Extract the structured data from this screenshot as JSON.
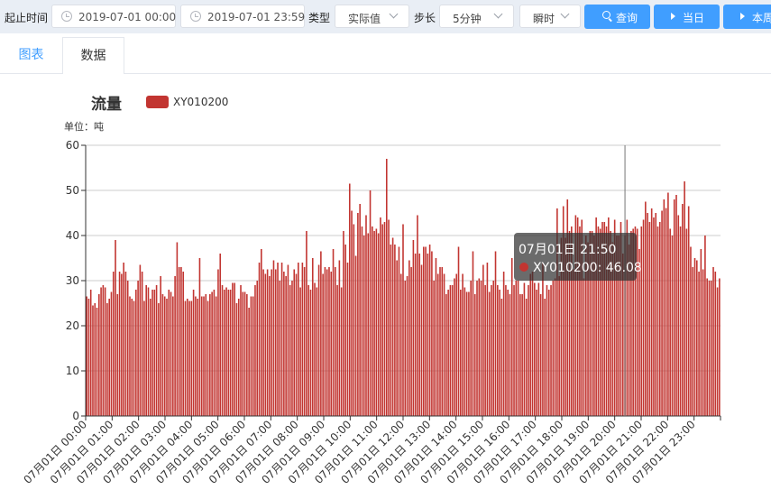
{
  "toolbar": {
    "range_label": "起止时间",
    "start": "2019-07-01 00:00",
    "end": "2019-07-01 23:59",
    "type_label": "类型",
    "type_value": "实际值",
    "step_label": "步长",
    "step_value": "5分钟",
    "mode_value": "瞬时",
    "query_btn": "查询",
    "today_btn": "当日",
    "week_btn": "本周"
  },
  "tabs": {
    "chart": "图表",
    "data": "数据"
  },
  "colors": {
    "bar": "#c23531",
    "accent": "#409eff",
    "toolbar_bg": "#e9eef5"
  },
  "chart_data": {
    "type": "bar",
    "title": "流量",
    "unit_label": "单位：吨",
    "ylim": [
      0,
      60
    ],
    "y_ticks": [
      "0",
      "10",
      "20",
      "30",
      "40",
      "50",
      "60"
    ],
    "grid": true,
    "legend": {
      "position": "top",
      "entries": [
        "XY010200"
      ]
    },
    "x_tick_labels": [
      "07月01日 00:00",
      "07月01日 01:00",
      "07月01日 02:00",
      "07月01日 03:00",
      "07月01日 04:00",
      "07月01日 05:00",
      "07月01日 06:00",
      "07月01日 07:00",
      "07月01日 08:00",
      "07月01日 09:00",
      "07月01日 10:00",
      "07月01日 11:00",
      "07月01日 12:00",
      "07月01日 13:00",
      "07月01日 14:00",
      "07月01日 15:00",
      "07月01日 16:00",
      "07月01日 17:00",
      "07月01日 18:00",
      "07月01日 19:00",
      "07月01日 20:00",
      "07月01日 21:00",
      "07月01日 22:00",
      "07月01日 23:00"
    ],
    "tooltip": {
      "time": "07月01日 21:50",
      "series": "XY010200",
      "value": "46.08",
      "index": 262
    },
    "series": [
      {
        "name": "XY010200",
        "values": [
          26.5,
          26,
          28,
          24.5,
          25,
          24,
          27,
          28.5,
          29,
          28.5,
          25,
          26,
          27.5,
          32,
          39,
          27,
          32,
          31.5,
          34,
          32,
          30,
          26.5,
          26,
          25.5,
          28,
          30,
          33.5,
          32,
          25.5,
          29,
          28.5,
          26,
          28,
          28,
          29,
          25,
          31,
          27,
          26.5,
          26,
          28,
          27.5,
          26.5,
          31,
          38.5,
          33,
          33,
          32,
          25.5,
          26,
          25.5,
          25.5,
          28,
          26.5,
          26,
          35,
          26.5,
          26.5,
          27,
          25.5,
          27,
          27.5,
          28,
          26.5,
          32.5,
          36,
          29,
          28,
          28.5,
          28,
          28,
          29.5,
          29.5,
          25,
          26,
          29,
          27.5,
          27.5,
          27,
          24,
          26.5,
          26.5,
          29,
          30,
          34,
          37,
          32.5,
          31.5,
          32.5,
          31,
          32.5,
          34.5,
          32.5,
          34,
          30,
          34,
          32,
          31,
          33.5,
          29,
          30,
          32.5,
          31.5,
          34,
          28.5,
          34,
          33,
          41,
          29,
          28,
          35,
          29.5,
          28.5,
          33.5,
          36.5,
          31.5,
          33,
          32.5,
          33,
          32,
          37,
          33,
          29,
          34.5,
          28.5,
          41,
          38,
          34,
          51.5,
          45.5,
          42.5,
          35.5,
          45,
          47,
          42,
          40,
          44.5,
          40.5,
          50,
          42,
          41,
          41.5,
          40.5,
          44,
          42.5,
          43,
          57,
          43.5,
          38,
          39.5,
          38,
          34.5,
          37.5,
          31.5,
          42.5,
          30,
          31,
          34.5,
          33,
          39,
          36,
          44.5,
          36,
          33.5,
          37.5,
          37.5,
          36,
          38,
          36.5,
          30,
          35,
          31.5,
          33,
          33,
          31.5,
          27,
          28,
          29,
          29,
          30.5,
          31.5,
          37.5,
          28,
          31.5,
          28.5,
          27.5,
          27.5,
          30,
          36.5,
          27,
          30,
          30.5,
          30,
          33.5,
          29,
          34,
          27.5,
          29,
          30,
          36.5,
          29,
          28,
          26,
          32,
          29,
          28,
          27,
          35,
          29,
          30,
          30,
          27,
          27,
          29.5,
          26,
          29,
          31.5,
          32,
          29.5,
          28,
          29.5,
          27,
          34,
          26,
          29,
          28,
          29,
          30,
          30.5,
          46,
          31,
          39.5,
          46.5,
          39.5,
          48,
          41,
          42,
          32.5,
          44.5,
          44,
          42,
          43.5,
          30.5,
          40,
          38.5,
          41,
          41,
          40,
          44,
          42,
          41.5,
          43,
          43,
          42,
          44,
          41,
          38.5,
          43.5,
          40,
          40,
          43,
          36,
          40,
          43.5,
          38,
          41,
          41.5,
          42,
          41.5,
          37,
          42,
          43.5,
          47.5,
          45,
          43,
          46,
          44,
          45,
          42,
          43,
          45.5,
          48,
          46.08,
          49.5,
          41.5,
          40,
          48,
          49,
          44.5,
          42,
          47,
          52,
          41.5,
          46.5,
          37.5,
          33,
          35,
          34.5,
          32,
          37,
          32.5,
          40,
          30.5,
          30,
          30,
          33,
          32,
          28.5,
          30.5
        ]
      }
    ]
  }
}
